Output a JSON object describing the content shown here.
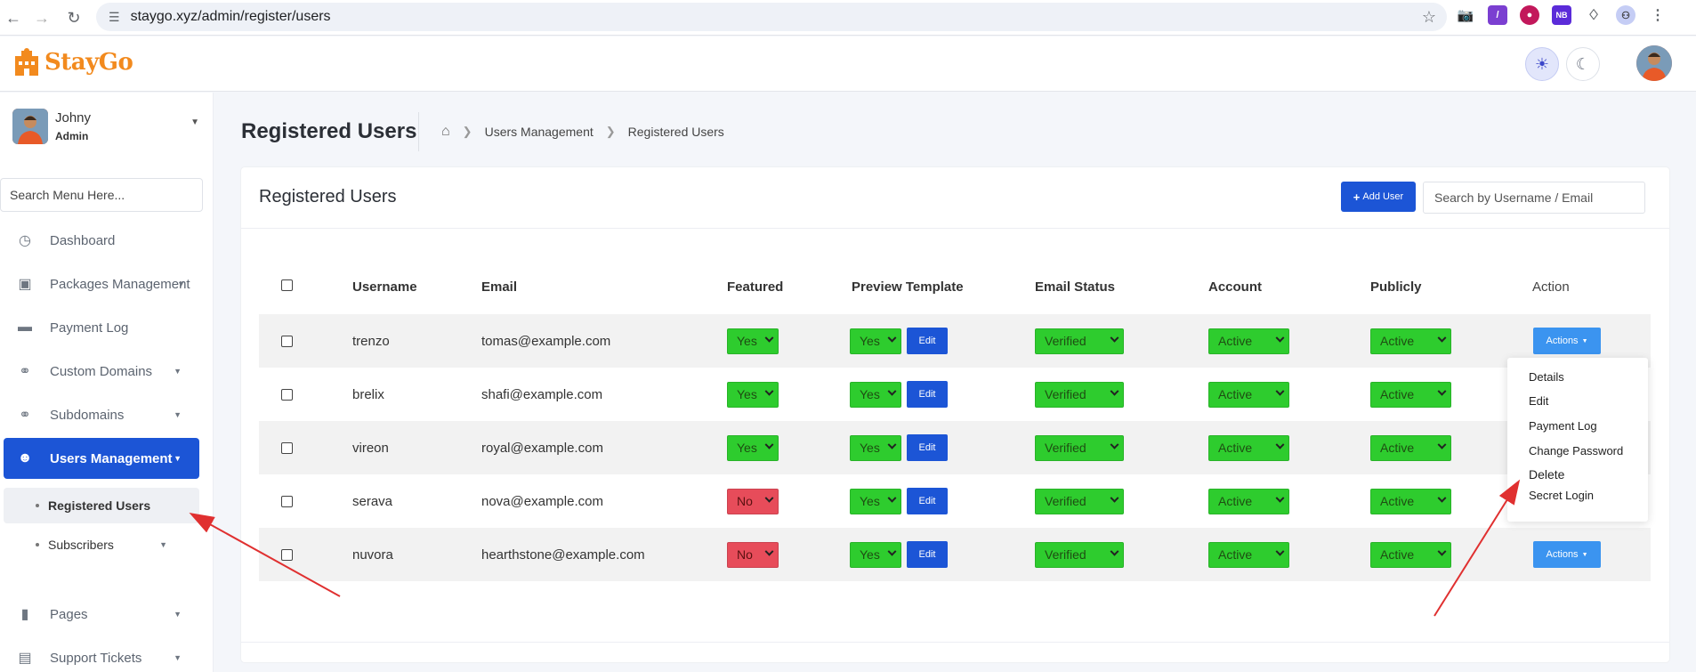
{
  "browser": {
    "url": "staygo.xyz/admin/register/users"
  },
  "app": {
    "logo_text": "StayGo"
  },
  "sidebar": {
    "user_name": "Johny",
    "user_role": "Admin",
    "search_placeholder": "Search Menu Here...",
    "items": [
      {
        "label": "Dashboard",
        "icon": "dashboard-icon"
      },
      {
        "label": "Packages Management",
        "icon": "box-icon"
      },
      {
        "label": "Payment Log",
        "icon": "money-icon"
      },
      {
        "label": "Custom Domains",
        "icon": "link-icon"
      },
      {
        "label": "Subdomains",
        "icon": "link-icon"
      },
      {
        "label": "Users Management",
        "icon": "users-icon"
      },
      {
        "label": "Registered Users"
      },
      {
        "label": "Subscribers"
      },
      {
        "label": "Pages",
        "icon": "file-icon"
      },
      {
        "label": "Support Tickets",
        "icon": "ticket-icon"
      }
    ]
  },
  "page": {
    "title": "Registered Users",
    "breadcrumb": [
      "Users Management",
      "Registered Users"
    ]
  },
  "card": {
    "title": "Registered Users",
    "add_button": "Add User",
    "search_placeholder": "Search by Username / Email"
  },
  "table": {
    "headers": [
      "Username",
      "Email",
      "Featured",
      "Preview Template",
      "Email Status",
      "Account",
      "Publicly",
      "Action"
    ],
    "edit_label": "Edit",
    "actions_label": "Actions",
    "rows": [
      {
        "username": "trenzo",
        "email": "tomas@example.com",
        "featured": "Yes",
        "preview": "Yes",
        "email_status": "Verified",
        "account": "Active",
        "publicly": "Active"
      },
      {
        "username": "brelix",
        "email": "shafi@example.com",
        "featured": "Yes",
        "preview": "Yes",
        "email_status": "Verified",
        "account": "Active",
        "publicly": "Active"
      },
      {
        "username": "vireon",
        "email": "royal@example.com",
        "featured": "Yes",
        "preview": "Yes",
        "email_status": "Verified",
        "account": "Active",
        "publicly": "Active"
      },
      {
        "username": "serava",
        "email": "nova@example.com",
        "featured": "No",
        "preview": "Yes",
        "email_status": "Verified",
        "account": "Active",
        "publicly": "Active"
      },
      {
        "username": "nuvora",
        "email": "hearthstone@example.com",
        "featured": "No",
        "preview": "Yes",
        "email_status": "Verified",
        "account": "Active",
        "publicly": "Active"
      }
    ]
  },
  "dropdown": {
    "items": [
      "Details",
      "Edit",
      "Payment Log",
      "Change Password",
      "Delete",
      "Secret Login"
    ]
  },
  "colors": {
    "primary": "#1c55d6",
    "green": "#2ecc2e",
    "red": "#e74c5a",
    "actions": "#3b94f0",
    "logo": "#f28a1e",
    "arrow": "#e03030"
  }
}
